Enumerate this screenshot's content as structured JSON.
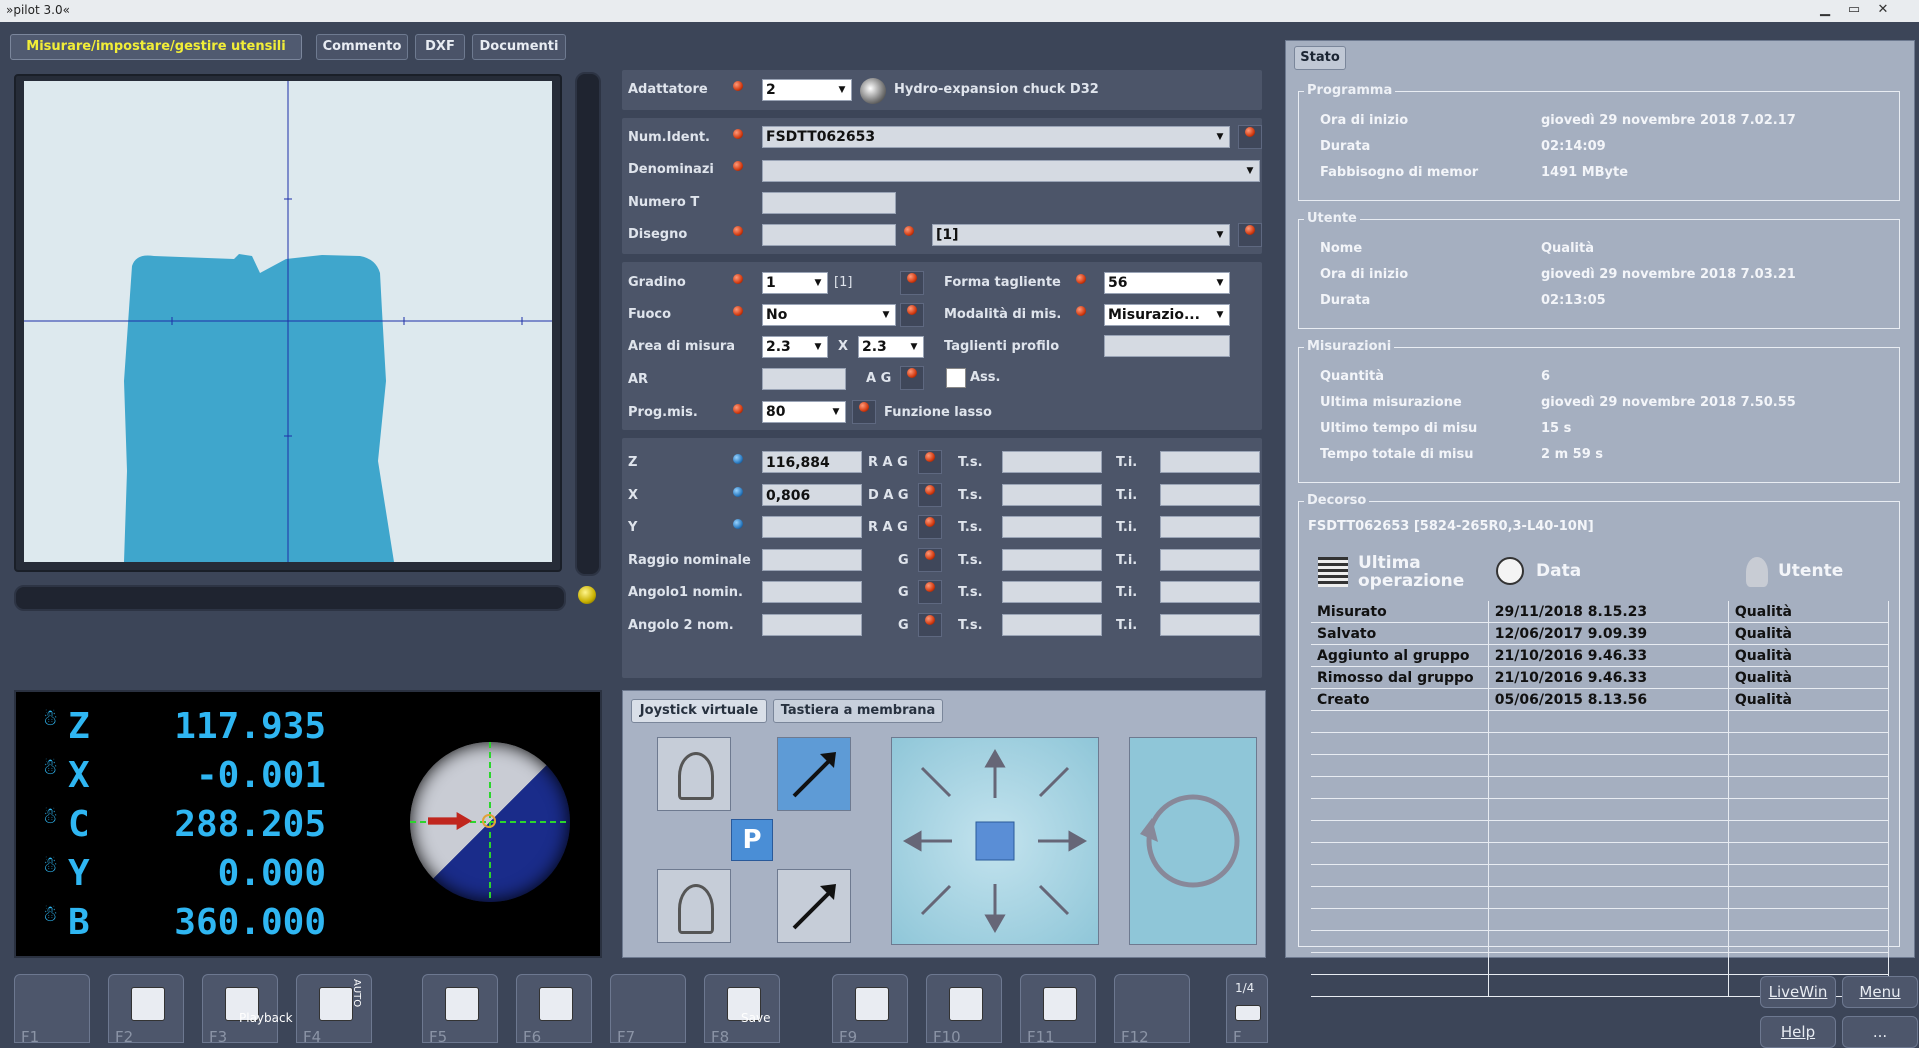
{
  "window": {
    "title": "»pilot 3.0«",
    "minimize": "▁",
    "restore": "▭",
    "close": "✕"
  },
  "tabs": [
    "Misurare/impostare/gestire utensili",
    "Commento",
    "DXF",
    "Documenti"
  ],
  "adapter": {
    "label": "Adattatore",
    "value": "2",
    "description": "Hydro-expansion chuck D32"
  },
  "ident": {
    "num_label": "Num.Ident.",
    "num_value": "FSDTT062653",
    "denom_label": "Denominazi",
    "denom_value": "",
    "numt_label": "Numero T",
    "numt_value": "",
    "disegno_label": "Disegno",
    "disegno_value": "",
    "disegno_combo": "[1]"
  },
  "params": {
    "gradino_label": "Gradino",
    "gradino_value": "1",
    "gradino_extra": "[1]",
    "forma_label": "Forma tagliente",
    "forma_value": "56",
    "fuoco_label": "Fuoco",
    "fuoco_value": "No",
    "modalita_label": "Modalità di mis.",
    "modalita_value": "Misurazio...",
    "area_label": "Area di misura",
    "area_x": "2.3",
    "area_sep": "X",
    "area_y": "2.3",
    "taglienti_label": "Taglienti profilo",
    "taglienti_value": "",
    "ar_label": "AR",
    "ar_value": "",
    "ag_label": "A G",
    "ass_label": "Ass.",
    "prog_label": "Prog.mis.",
    "prog_value": "80",
    "lasso_label": "Funzione lasso"
  },
  "measure": {
    "ts": "T.s.",
    "ti": "T.i.",
    "rows": [
      {
        "label": "Z",
        "value": "116,884",
        "tag": "R A G"
      },
      {
        "label": "X",
        "value": "0,806",
        "tag": "D A G"
      },
      {
        "label": "Y",
        "value": "",
        "tag": "R A G"
      },
      {
        "label": "Raggio nominale",
        "value": "",
        "tag": "G"
      },
      {
        "label": "Angolo1 nomin.",
        "value": "",
        "tag": "G"
      },
      {
        "label": "Angolo 2 nom.",
        "value": "",
        "tag": "G"
      }
    ]
  },
  "dro": [
    {
      "axis": "Z",
      "value": "117.935"
    },
    {
      "axis": "X",
      "value": "-0.001"
    },
    {
      "axis": "C",
      "value": "288.205"
    },
    {
      "axis": "Y",
      "value": "0.000"
    },
    {
      "axis": "B",
      "value": "360.000"
    }
  ],
  "joystick": {
    "tab_virtual": "Joystick virtuale",
    "tab_membrane": "Tastiera a membrana",
    "park": "P"
  },
  "stato": {
    "tab": "Stato",
    "programma": {
      "title": "Programma",
      "rows": [
        [
          "Ora di inizio",
          "giovedì 29 novembre 2018 7.02.17"
        ],
        [
          "Durata",
          "02:14:09"
        ],
        [
          "Fabbisogno di memor",
          "1491 MByte"
        ]
      ]
    },
    "utente": {
      "title": "Utente",
      "rows": [
        [
          "Nome",
          "Qualità"
        ],
        [
          "Ora di inizio",
          "giovedì 29 novembre 2018 7.03.21"
        ],
        [
          "Durata",
          "02:13:05"
        ]
      ]
    },
    "misurazioni": {
      "title": "Misurazioni",
      "rows": [
        [
          "Quantità",
          "6"
        ],
        [
          "Ultima misurazione",
          "giovedì 29 novembre 2018 7.50.55"
        ],
        [
          "Ultimo tempo di misu",
          "15 s"
        ],
        [
          "Tempo totale di misu",
          "2 m 59 s"
        ]
      ]
    },
    "decorso": {
      "title": "Decorso",
      "tool": "FSDTT062653 [5824-265R0,3-L40-10N]",
      "col_op": "Ultima operazione",
      "col_op1": "Ultima",
      "col_op2": "operazione",
      "col_date": "Data",
      "col_user": "Utente",
      "rows": [
        [
          "Misurato",
          "29/11/2018 8.15.23",
          "Qualità"
        ],
        [
          "Salvato",
          "12/06/2017 9.09.39",
          "Qualità"
        ],
        [
          "Aggiunto al gruppo",
          "21/10/2016 9.46.33",
          "Qualità"
        ],
        [
          "Rimosso dal gruppo",
          "21/10/2016 9.46.33",
          "Qualità"
        ],
        [
          "Creato",
          "05/06/2015 8.13.56",
          "Qualità"
        ]
      ]
    }
  },
  "fkeys": {
    "f1": "F1",
    "f2": "F2",
    "f3": "F3",
    "f3_sub": "Playback",
    "f4": "F4",
    "f4_sub": "AUTO",
    "f5": "F5",
    "f6": "F6",
    "f7": "F7",
    "f8": "F8",
    "f8_sub": "Save",
    "f9": "F9",
    "f10": "F10",
    "f11": "F11",
    "f12": "F12",
    "page": "1/4",
    "f_last": "F"
  },
  "right_buttons": {
    "livewin": "LiveWin",
    "menu": "Menu",
    "help": "Help",
    "more": "..."
  },
  "colors": {
    "accent_tab": "#f2ee37",
    "dro": "#2fb6f2",
    "tool_profile": "#3fa6cc",
    "led": "#d23a10"
  }
}
